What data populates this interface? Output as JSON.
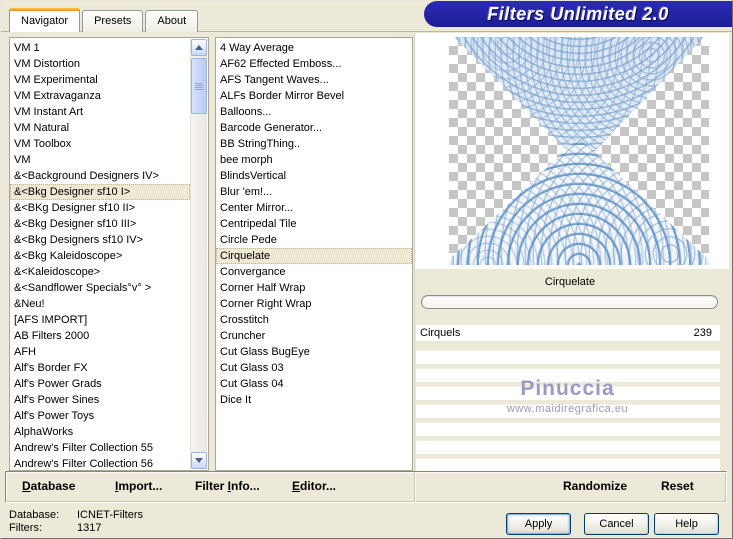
{
  "window": {
    "title": "Filters Unlimited 2.0"
  },
  "tabs": {
    "items": [
      {
        "label": "Navigator",
        "active": true
      },
      {
        "label": "Presets"
      },
      {
        "label": "About"
      }
    ]
  },
  "category_list": {
    "selected": "&<Bkg Designer sf10 I>",
    "items": [
      "VM 1",
      "VM Distortion",
      "VM Experimental",
      "VM Extravaganza",
      "VM Instant Art",
      "VM Natural",
      "VM Toolbox",
      "VM",
      "&<Background Designers IV>",
      "&<Bkg Designer sf10 I>",
      "&<BKg Designer sf10 II>",
      "&<Bkg Designer sf10 III>",
      "&<Bkg Designers sf10 IV>",
      "&<Bkg Kaleidoscope>",
      "&<Kaleidoscope>",
      "&<Sandflower Specials°v° >",
      "&Neu!",
      "[AFS IMPORT]",
      "AB Filters 2000",
      "AFH",
      "Alf's Border FX",
      "Alf's Power Grads",
      "Alf's Power Sines",
      "Alf's Power Toys",
      "AlphaWorks",
      "Andrew's Filter Collection 55",
      "Andrew's Filter Collection 56"
    ]
  },
  "filter_list": {
    "selected": "Cirquelate",
    "items": [
      "4 Way Average",
      "AF62 Effected Emboss...",
      "AFS Tangent Waves...",
      "ALFs Border Mirror Bevel",
      "Balloons...",
      "Barcode Generator...",
      "BB StringThing..",
      "bee morph",
      "BlindsVertical",
      "Blur 'em!...",
      "Center Mirror...",
      "Centripedal Tile",
      "Circle Pede",
      "Cirquelate",
      "Convergance",
      "Corner Half Wrap",
      "Corner Right Wrap",
      "Crosstitch",
      "Cruncher",
      "Cut Glass  BugEye",
      "Cut Glass 03",
      "Cut Glass 04",
      "Dice It"
    ]
  },
  "params": {
    "title": "Cirquelate",
    "rows": [
      {
        "name": "Cirquels",
        "value": "239"
      }
    ],
    "empty_rows": [
      "",
      "",
      "",
      "",
      "",
      "",
      ""
    ]
  },
  "watermark": {
    "name": "Pinuccia",
    "url": "www.maidiregrafica.eu"
  },
  "actions": {
    "database": {
      "pre": "",
      "mn": "D",
      "post": "atabase"
    },
    "import": {
      "pre": "",
      "mn": "I",
      "post": "mport..."
    },
    "filter_info": {
      "pre": "Filter ",
      "mn": "I",
      "post": "nfo..."
    },
    "editor": {
      "pre": "",
      "mn": "E",
      "post": "ditor..."
    },
    "randomize": "Randomize",
    "reset": "Reset"
  },
  "status": {
    "database_label": "Database:",
    "database_value": "ICNET-Filters",
    "filters_label": "Filters:",
    "filters_value": "1317"
  },
  "dialog_buttons": {
    "apply": "Apply",
    "cancel": "Cancel",
    "help": "Help"
  },
  "colors": {
    "dialog_bg": "#ECE9D8",
    "banner_blue": "#22229E",
    "tab_accent_orange": "#E5912D",
    "selection_bg": "#EDE9D3",
    "preview_ripple_blue": "#7FA8D4",
    "checker_gray": "#C6C6C6",
    "watermark": "#9A9AC4"
  }
}
